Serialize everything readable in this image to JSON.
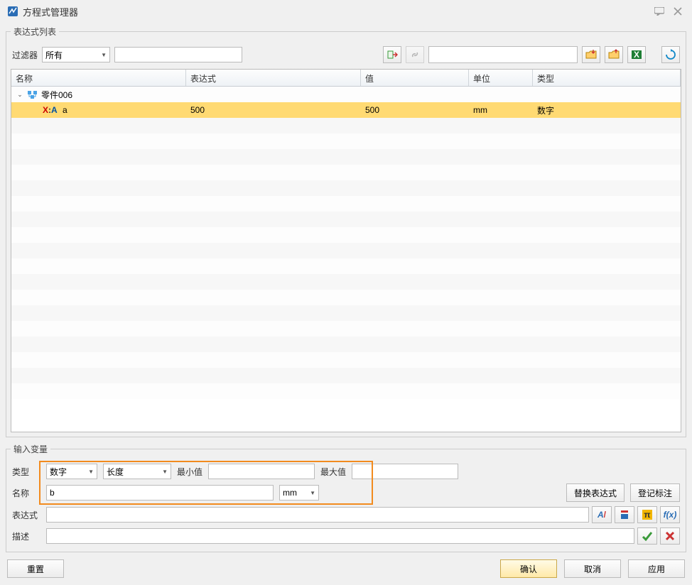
{
  "window": {
    "title": "方程式管理器"
  },
  "panels": {
    "expr_list": "表达式列表",
    "input_var": "输入变量"
  },
  "filter": {
    "label": "过滤器",
    "combo_value": "所有",
    "search_value": ""
  },
  "toolbar_icons": {
    "insert": "插入",
    "link": "关联",
    "folder_open": "打开",
    "folder_export": "导出",
    "excel": "Excel",
    "refresh": "刷新"
  },
  "columns": {
    "name": "名称",
    "expr": "表达式",
    "value": "值",
    "unit": "单位",
    "type": "类型"
  },
  "tree": {
    "group_label": "零件006",
    "rows": [
      {
        "name": "a",
        "expr": "500",
        "value": "500",
        "unit": "mm",
        "type": "数字"
      }
    ]
  },
  "input": {
    "type_label": "类型",
    "type_value": "数字",
    "qty_label": "长度",
    "min_label": "最小值",
    "min_value": "",
    "max_label": "最大值",
    "max_value": "",
    "name_label": "名称",
    "name_value": "b",
    "unit_value": "mm",
    "replace_btn": "替换表达式",
    "annotate_btn": "登记标注",
    "expr_label": "表达式",
    "expr_value": "",
    "desc_label": "描述",
    "desc_value": ""
  },
  "actions": {
    "reset": "重置",
    "ok": "确认",
    "cancel": "取消",
    "apply": "应用"
  }
}
